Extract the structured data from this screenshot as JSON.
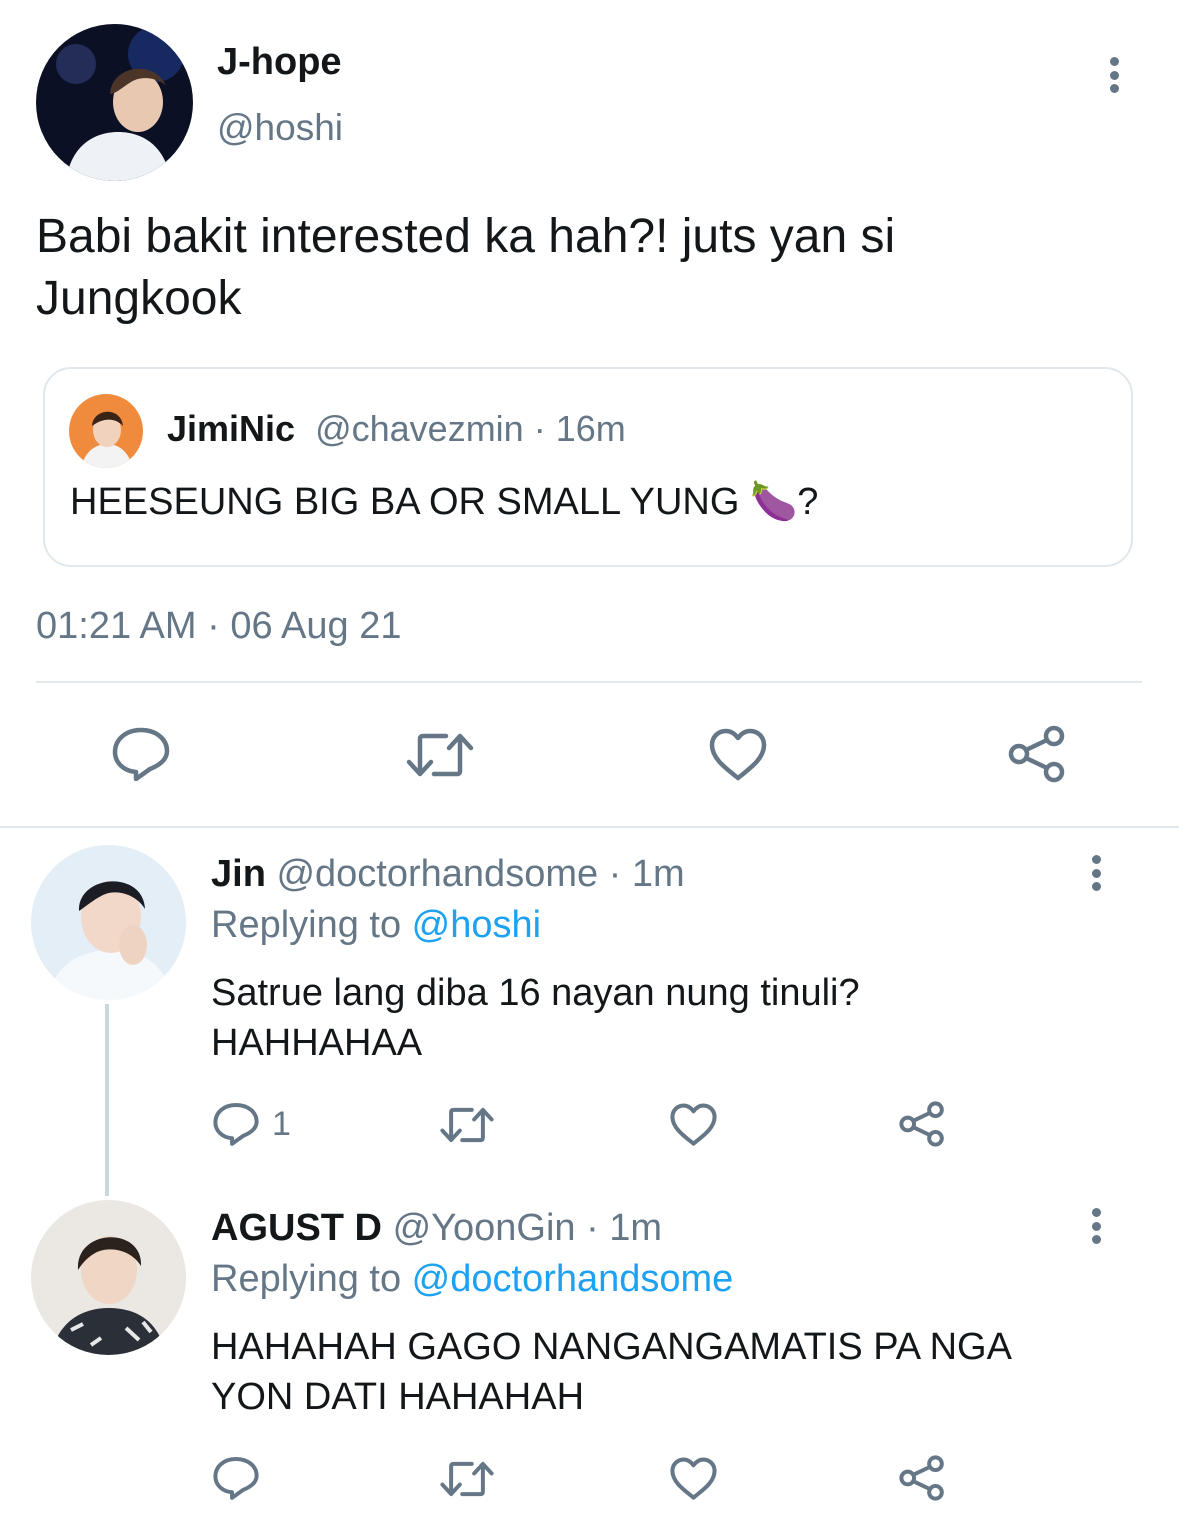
{
  "main_tweet": {
    "display_name": "J-hope",
    "handle": "@hoshi",
    "text_line1": "Babi bakit interested ka hah?!  juts yan si",
    "text_line2": "Jungkook",
    "timestamp": "01:21 AM · 06 Aug 21",
    "quoted": {
      "display_name": "JimiNic",
      "handle": "@chavezmin",
      "time": " · 16m",
      "text": "HEESEUNG BIG BA OR SMALL YUNG 🍆?"
    }
  },
  "replies": [
    {
      "display_name": "Jin",
      "handle": "@doctorhandsome",
      "time": " · 1m",
      "replying_label": "Replying to ",
      "replying_to": "@hoshi",
      "text_line1": "Satrue lang diba 16 nayan nung tinuli?",
      "text_line2": "HAHHAHAA",
      "reply_count": "1"
    },
    {
      "display_name": "AGUST D",
      "handle": "@YoonGin",
      "time": " · 1m",
      "replying_label": "Replying to ",
      "replying_to": "@doctorhandsome",
      "text_line1": "HAHAHAH GAGO NANGANGAMATIS PA NGA",
      "text_line2": "YON DATI HAHAHAH"
    }
  ],
  "colors": {
    "text": "#14171a",
    "muted": "#657786",
    "link": "#1da1f2",
    "divider": "#e1e8ed"
  },
  "icons": [
    "more-vertical-icon",
    "reply-icon",
    "retweet-icon",
    "like-icon",
    "share-icon"
  ]
}
